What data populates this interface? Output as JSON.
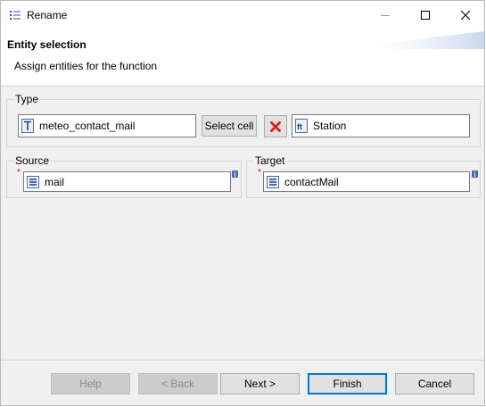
{
  "window": {
    "title": "Rename",
    "app_icon": "list-icon",
    "controls": [
      "minimize-icon",
      "maximize-icon",
      "close-icon"
    ]
  },
  "header": {
    "title": "Entity selection",
    "description": "Assign entities for the function"
  },
  "type_group": {
    "label": "Type",
    "type_value": "meteo_contact_mail",
    "type_icon": "type-t-icon",
    "select_cell_label": "Select cell",
    "delete_icon": "red-x-icon",
    "station_value": "Station",
    "station_icon": "feature-type-icon"
  },
  "source": {
    "label": "Source",
    "required_marker": "*",
    "value": "mail",
    "value_icon": "property-icon",
    "info_icon": "info-icon"
  },
  "target": {
    "label": "Target",
    "required_marker": "*",
    "value": "contactMail",
    "value_icon": "property-icon",
    "info_icon": "info-icon"
  },
  "buttons": {
    "help": "Help",
    "back": "< Back",
    "next": "Next >",
    "finish": "Finish",
    "cancel": "Cancel"
  },
  "colors": {
    "accent": "#0078d7",
    "required": "#d00000",
    "delete": "#d9262b"
  }
}
